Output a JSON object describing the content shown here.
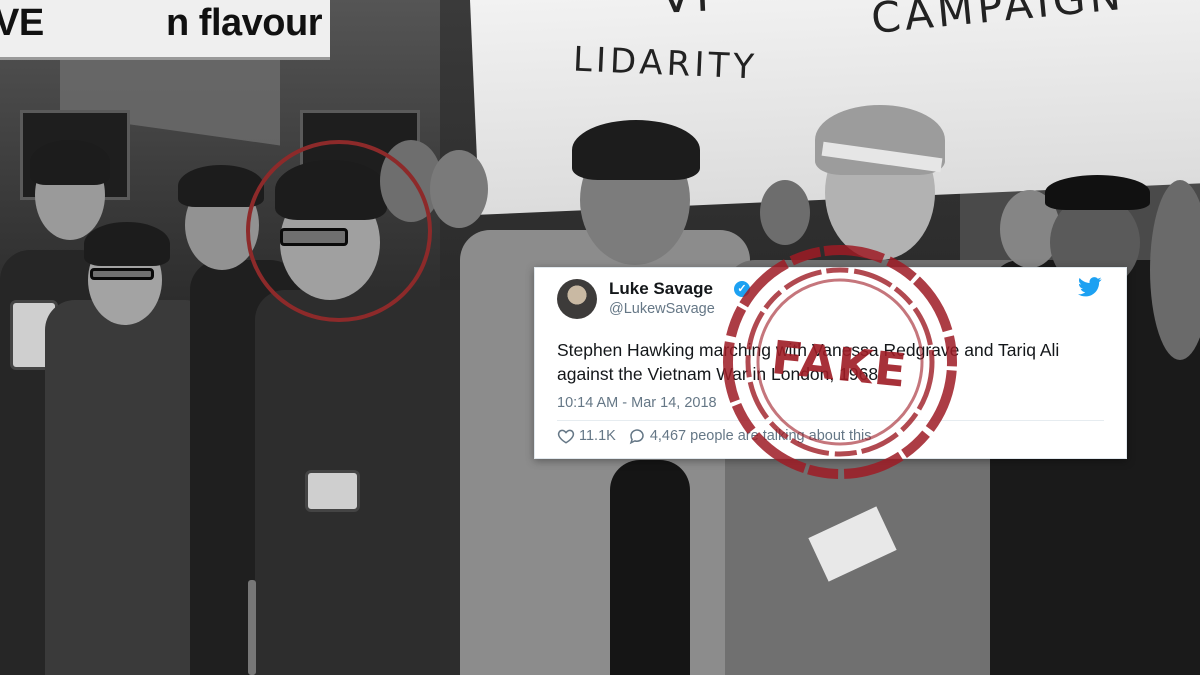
{
  "photo": {
    "description_icon": "protest-march-photo",
    "bus_sign_text": "n flavour",
    "bus_sign_left_fragment": "VE",
    "banner": {
      "top_fragment": "VI",
      "campaign": "CAMPAIGN",
      "solidarity": "LIDARITY"
    }
  },
  "highlight": {
    "color": "#8d2a2a"
  },
  "tweet": {
    "name": "Luke Savage",
    "handle": "@LukewSavage",
    "text": "Stephen Hawking marching with Vanessa Redgrave and Tariq Ali against the Vietnam War in London, 1968",
    "timestamp": "10:14 AM - Mar 14, 2018",
    "likes": "11.1K",
    "talking": "4,467 people are talking about this",
    "icons": {
      "verified": "verified-badge-icon",
      "brand": "twitter-bird-icon",
      "like": "heart-icon",
      "reply": "comment-icon"
    },
    "colors": {
      "brand": "#1da1f2",
      "text": "#14171a",
      "muted": "#657786"
    }
  },
  "stamp": {
    "text": "FAKE",
    "color": "#9e1b24"
  }
}
